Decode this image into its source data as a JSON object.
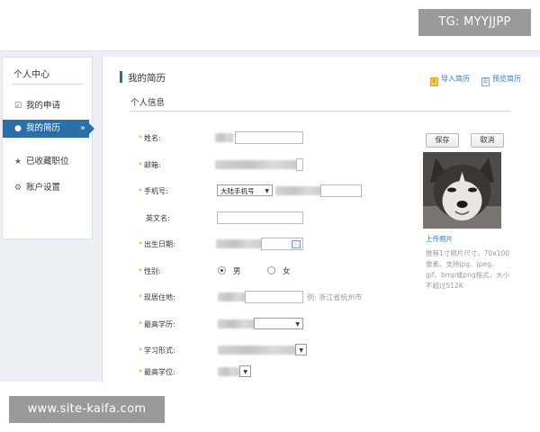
{
  "watermarks": {
    "top": "TG: MYYJJPP",
    "bottom": "www.site-kaifa.com"
  },
  "sidebar": {
    "title": "个人中心",
    "items": [
      {
        "label": "我的申请",
        "icon": "checkbox-icon"
      },
      {
        "label": "我的简历",
        "icon": "user-icon",
        "active": true,
        "chevron": "»"
      },
      {
        "label": "已收藏职位",
        "icon": "star-icon"
      },
      {
        "label": "账户设置",
        "icon": "gear-icon"
      }
    ]
  },
  "page": {
    "title": "我的简历",
    "import_label": "导入简历",
    "preview_label": "预览简历",
    "section_title": "个人信息"
  },
  "form": {
    "name": {
      "label": "姓名:",
      "required": true
    },
    "email": {
      "label": "邮箱:",
      "required": true
    },
    "phone": {
      "label": "手机号:",
      "required": true,
      "region": "大陆手机号"
    },
    "english_name": {
      "label": "英文名:",
      "required": false
    },
    "birth_date": {
      "label": "出生日期:",
      "required": true
    },
    "gender": {
      "label": "性别:",
      "required": true,
      "options": [
        "男",
        "女"
      ],
      "selected": "男"
    },
    "residence": {
      "label": "现居住地:",
      "required": true,
      "hint": "例: 浙江省杭州市"
    },
    "education": {
      "label": "最高学历:",
      "required": true
    },
    "study_mode": {
      "label": "学习形式:",
      "required": true
    },
    "degree": {
      "label": "最高学位:",
      "required": true
    }
  },
  "actions": {
    "save": "保存",
    "cancel": "取消"
  },
  "photo": {
    "upload_label": "上传照片",
    "hint": "推荐1寸照片尺寸，70x100像素。支持jpg、jpeg、gif、bmp或png格式，大小不超过512K"
  },
  "colors": {
    "accent": "#2a6fa8",
    "link": "#3a78b5",
    "required_mark": "#e0a020"
  }
}
